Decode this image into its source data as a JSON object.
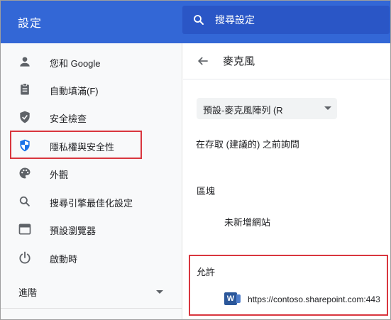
{
  "header": {
    "title": "設定",
    "search_placeholder": "搜尋設定"
  },
  "sidebar": {
    "items": [
      {
        "label": "您和 Google",
        "icon": "person-icon"
      },
      {
        "label": "自動填滿(F)",
        "icon": "clipboard-icon"
      },
      {
        "label": "安全檢查",
        "icon": "shield-check-icon"
      },
      {
        "label": "隱私權與安全性",
        "icon": "shield-privacy-icon"
      },
      {
        "label": "外觀",
        "icon": "palette-icon"
      },
      {
        "label": "搜尋引擎最佳化設定",
        "icon": "search-icon"
      },
      {
        "label": "預設瀏覽器",
        "icon": "browser-icon"
      },
      {
        "label": "啟動時",
        "icon": "power-icon"
      }
    ],
    "advanced_label": "進階"
  },
  "main": {
    "title": "麥克風",
    "select_value": "預設-麥克風陣列 (R",
    "ask_label": "在存取 (建議的) 之前詢問",
    "block": {
      "title": "區塊",
      "empty_text": "未新增網站"
    },
    "allow": {
      "title": "允許",
      "site_icon_letter": "W",
      "site_url": "https://contoso.sharepoint.com:443"
    }
  },
  "colors": {
    "header_bg": "#3367d6",
    "search_bg": "#2a56c6",
    "highlight": "#d9363e",
    "privacy_icon": "#1a73e8"
  }
}
